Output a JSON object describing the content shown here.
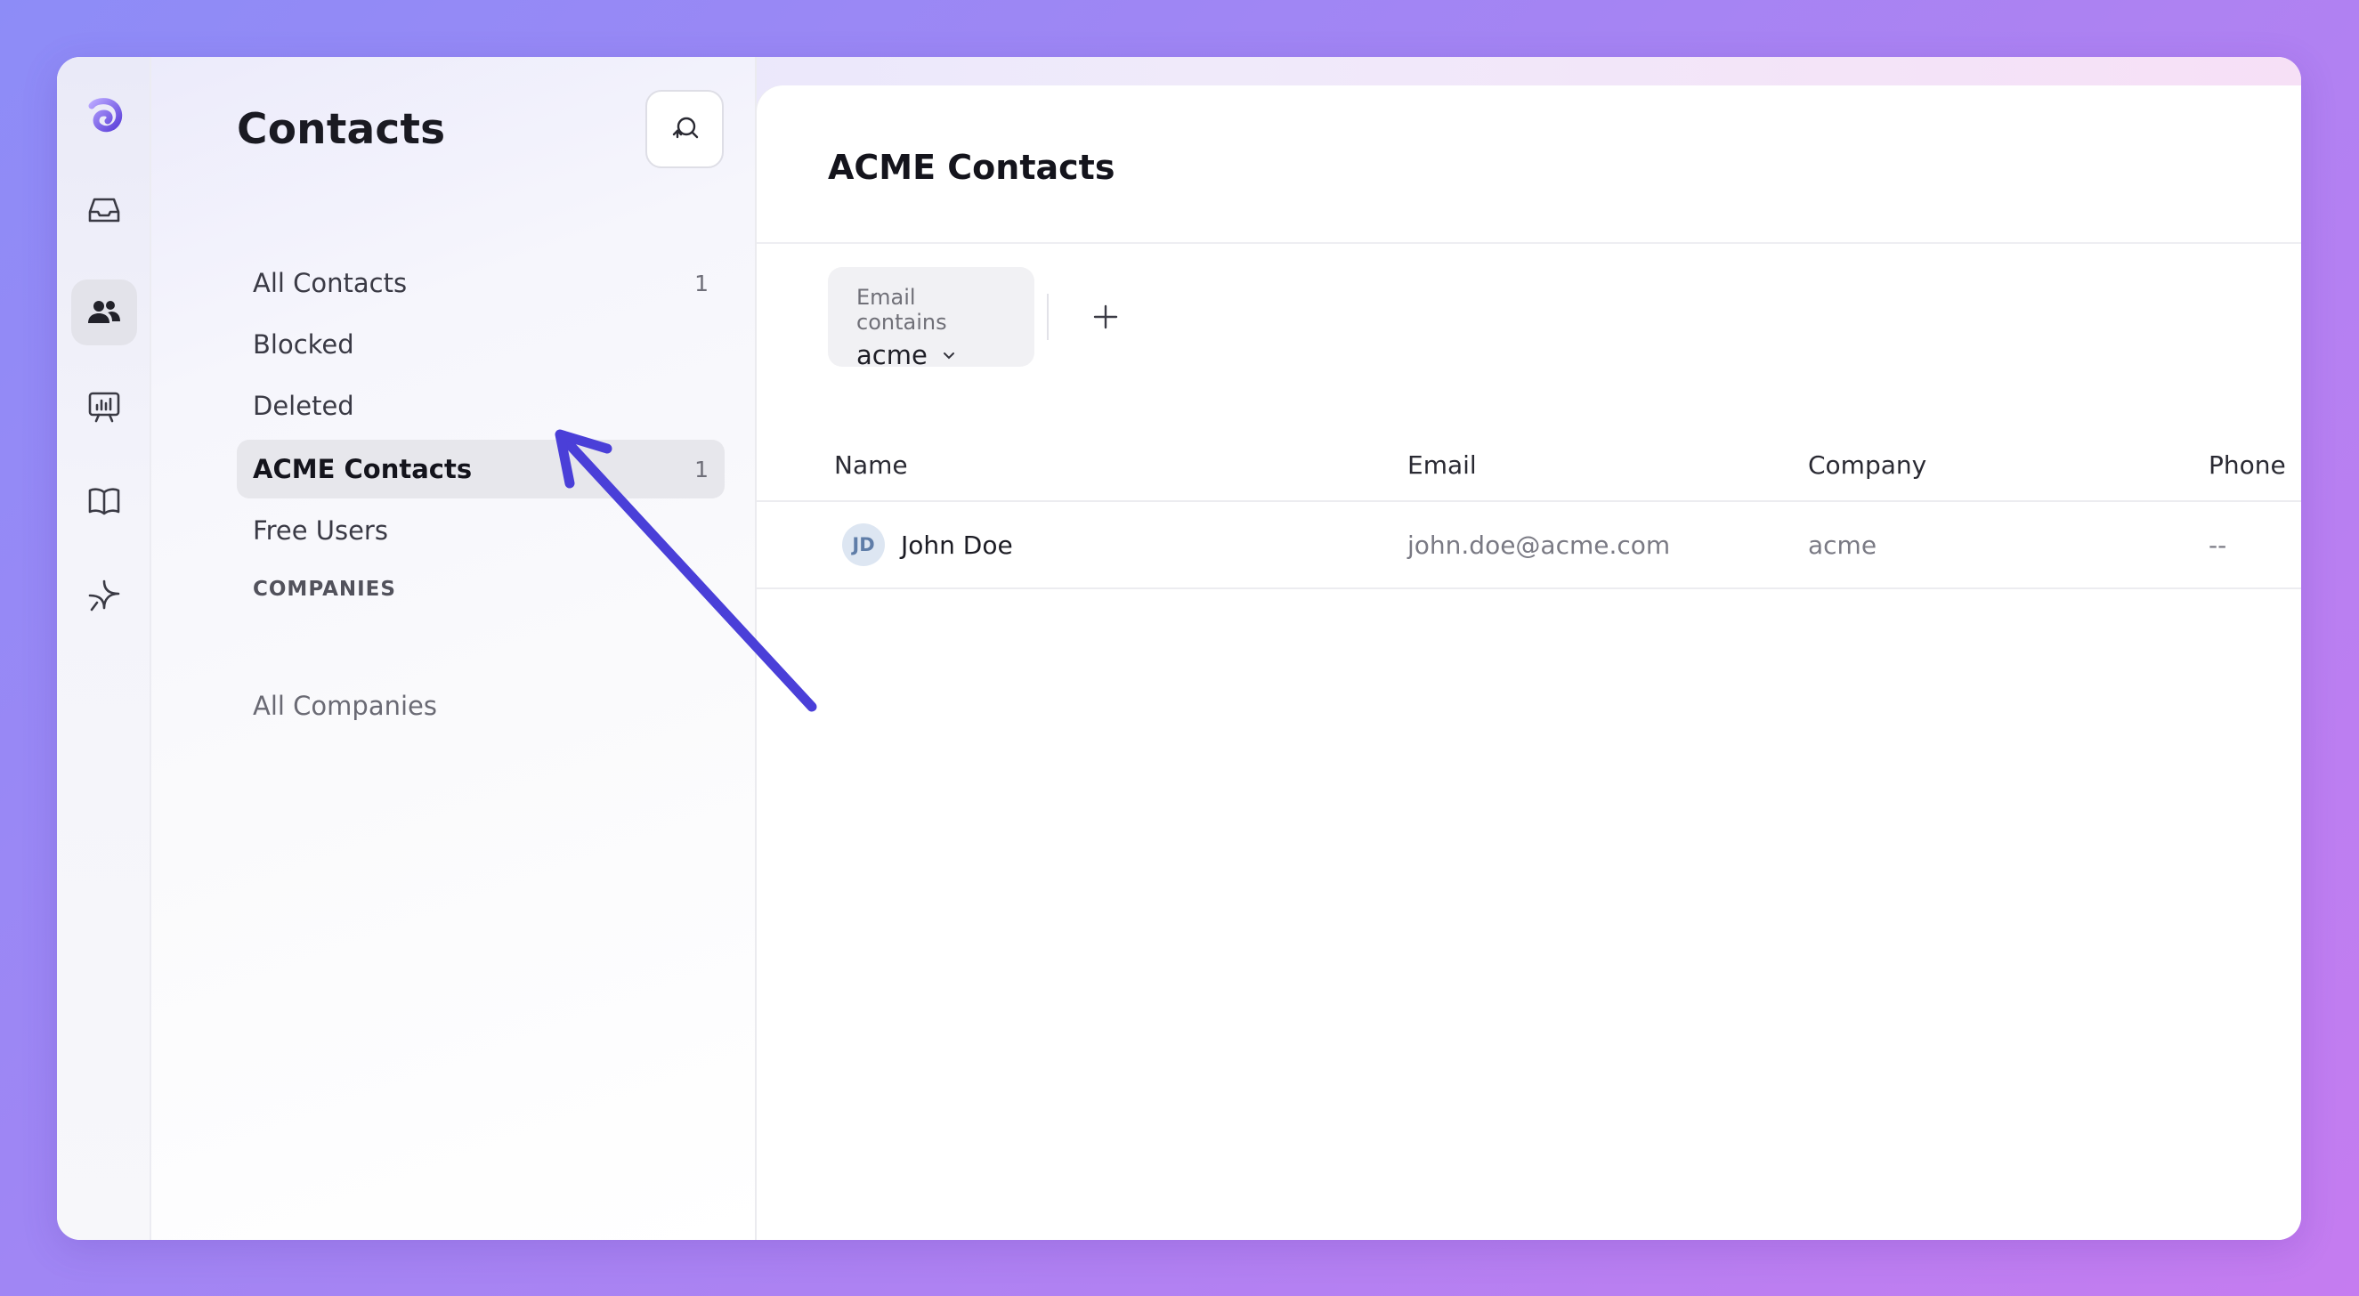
{
  "rail": {
    "items": [
      {
        "icon": "logo-icon"
      },
      {
        "icon": "inbox-icon"
      },
      {
        "icon": "contacts-icon",
        "active": true
      },
      {
        "icon": "reports-icon"
      },
      {
        "icon": "knowledge-base-icon"
      },
      {
        "icon": "sparkle-icon"
      }
    ],
    "accent": "#6f5ce8"
  },
  "panel": {
    "title": "Contacts",
    "action_icon": "refresh-search-icon",
    "nav": [
      {
        "label": "All Contacts",
        "count": "1"
      },
      {
        "label": "Blocked",
        "count": ""
      },
      {
        "label": "Deleted",
        "count": ""
      },
      {
        "label": "ACME Contacts",
        "count": "1",
        "active": true
      },
      {
        "label": "Free Users",
        "count": ""
      }
    ],
    "companies_section": "COMPANIES",
    "companies_nav": [
      {
        "label": "All Companies"
      }
    ]
  },
  "main": {
    "title": "ACME Contacts",
    "filter": {
      "label": "Email contains",
      "value": "acme"
    },
    "table": {
      "columns": [
        "Name",
        "Email",
        "Company",
        "Phone"
      ],
      "rows": [
        {
          "initials": "JD",
          "name": "John Doe",
          "email": "john.doe@acme.com",
          "company": "acme",
          "phone": "--"
        }
      ]
    }
  },
  "annotation": {
    "color": "#4a3fd8",
    "points_to": "ACME Contacts"
  }
}
